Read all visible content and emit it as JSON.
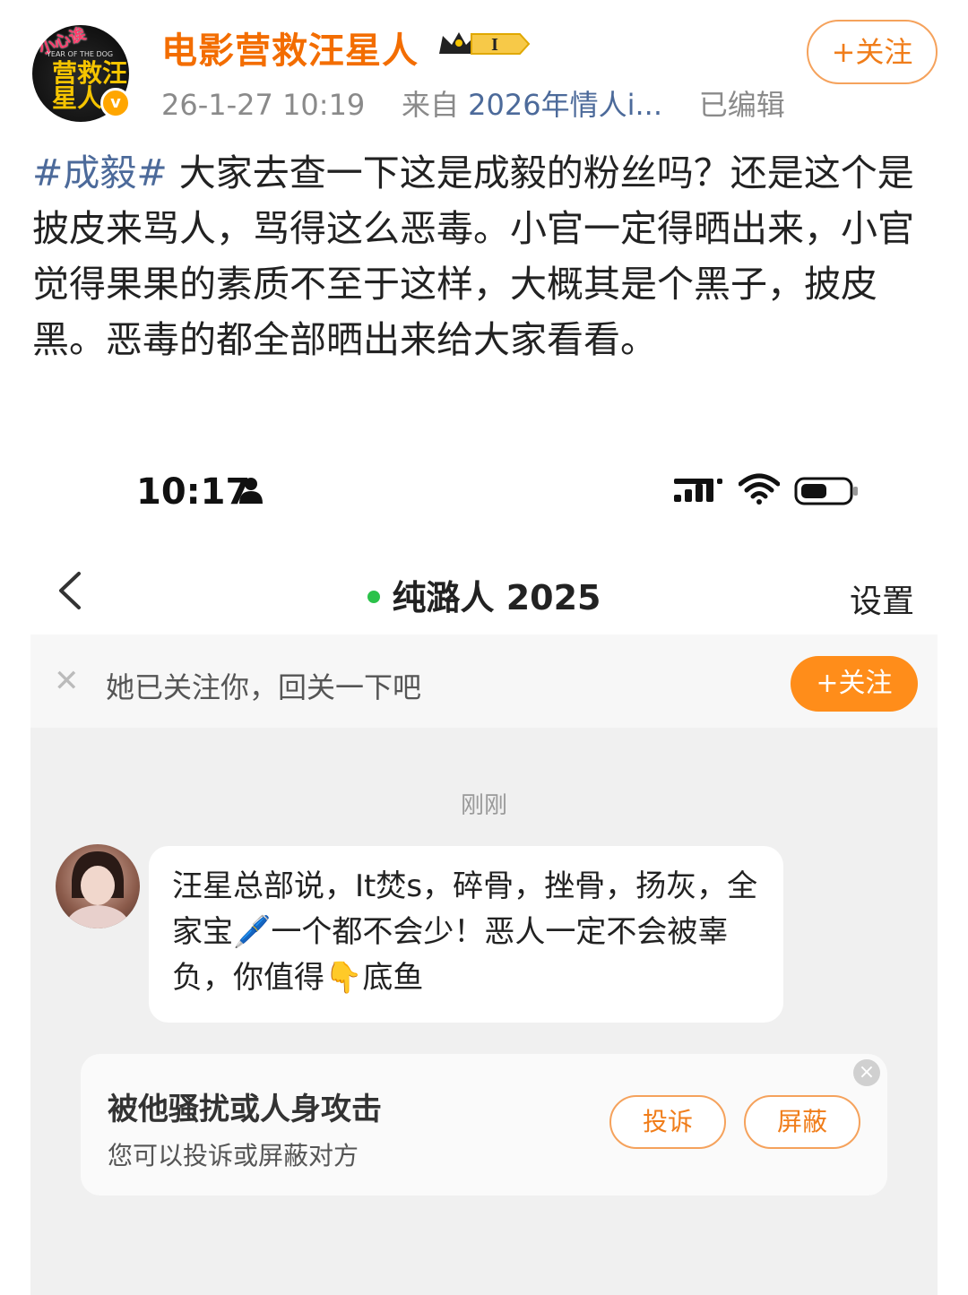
{
  "post_header": {
    "username": "电影营救汪星人",
    "timestamp": "26-1-27 10:19",
    "source_prefix": "来自",
    "source": "2026年情人i...",
    "edited": "已编辑",
    "follow_label": "+关注",
    "avatar_text": "营救汪星人",
    "avatar_badge": "小心诶",
    "avatar_small": "YEAR OF THE DOG",
    "verified_mark": "v",
    "level": "I"
  },
  "post": {
    "hashtag": "#成毅#",
    "body": " 大家去查一下这是成毅的粉丝吗？还是这个是披皮来骂人，骂得这么恶毒。小官一定得晒出来，小官觉得果果的素质不至于这样，大概其是个黑子，披皮黑。恶毒的都全部晒出来给大家看看。"
  },
  "screenshot": {
    "status": {
      "time": "10:17"
    },
    "nav": {
      "title": "纯潞人 2025",
      "settings": "设置"
    },
    "follow_bar": {
      "close": "✕",
      "text": "她已关注你，回关一下吧",
      "button": "+关注"
    },
    "chat": {
      "timestamp": "刚刚",
      "message": "汪星总部说，It焚s，碎骨，挫骨，扬灰，全家宝🖊️一个都不会少！恶人一定不会被辜负，你值得👇底鱼"
    },
    "report_card": {
      "title": "被他骚扰或人身攻击",
      "subtitle": "您可以投诉或屏蔽对方",
      "report_button": "投诉",
      "block_button": "屏蔽",
      "close": "×"
    }
  },
  "colors": {
    "username": "#f36d00",
    "hashtag": "#4c6a9a",
    "accent": "#ff8d1a",
    "online": "#2bc24a"
  }
}
